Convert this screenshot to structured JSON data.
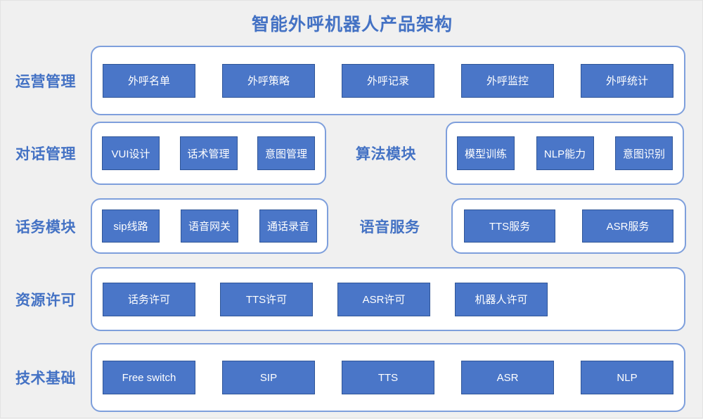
{
  "title": "智能外呼机器人产品架构",
  "theme": {
    "accent": "#4472c4",
    "node_fill": "#4a76c8",
    "node_border": "#2f5597",
    "group_border": "#7e9fdc",
    "background": "#f0f0f0"
  },
  "rows": [
    {
      "id": "row1",
      "label": "运营管理",
      "groups": [
        {
          "nodes": [
            "外呼名单",
            "外呼策略",
            "外呼记录",
            "外呼监控",
            "外呼统计"
          ]
        }
      ]
    },
    {
      "id": "row2",
      "label": "对话管理",
      "label_right": "算法模块",
      "groups": [
        {
          "nodes": [
            "VUI设计",
            "话术管理",
            "意图管理"
          ]
        },
        {
          "nodes": [
            "模型训练",
            "NLP能力",
            "意图识别"
          ]
        }
      ]
    },
    {
      "id": "row3",
      "label": "话务模块",
      "label_right": "语音服务",
      "groups": [
        {
          "nodes": [
            "sip线路",
            "语音网关",
            "通话录音"
          ]
        },
        {
          "nodes": [
            "TTS服务",
            "ASR服务"
          ]
        }
      ]
    },
    {
      "id": "row4",
      "label": "资源许可",
      "groups": [
        {
          "nodes": [
            "话务许可",
            "TTS许可",
            "ASR许可",
            "机器人许可"
          ]
        }
      ]
    },
    {
      "id": "row5",
      "label": "技术基础",
      "groups": [
        {
          "nodes": [
            "Free switch",
            "SIP",
            "TTS",
            "ASR",
            "NLP"
          ]
        }
      ]
    }
  ]
}
